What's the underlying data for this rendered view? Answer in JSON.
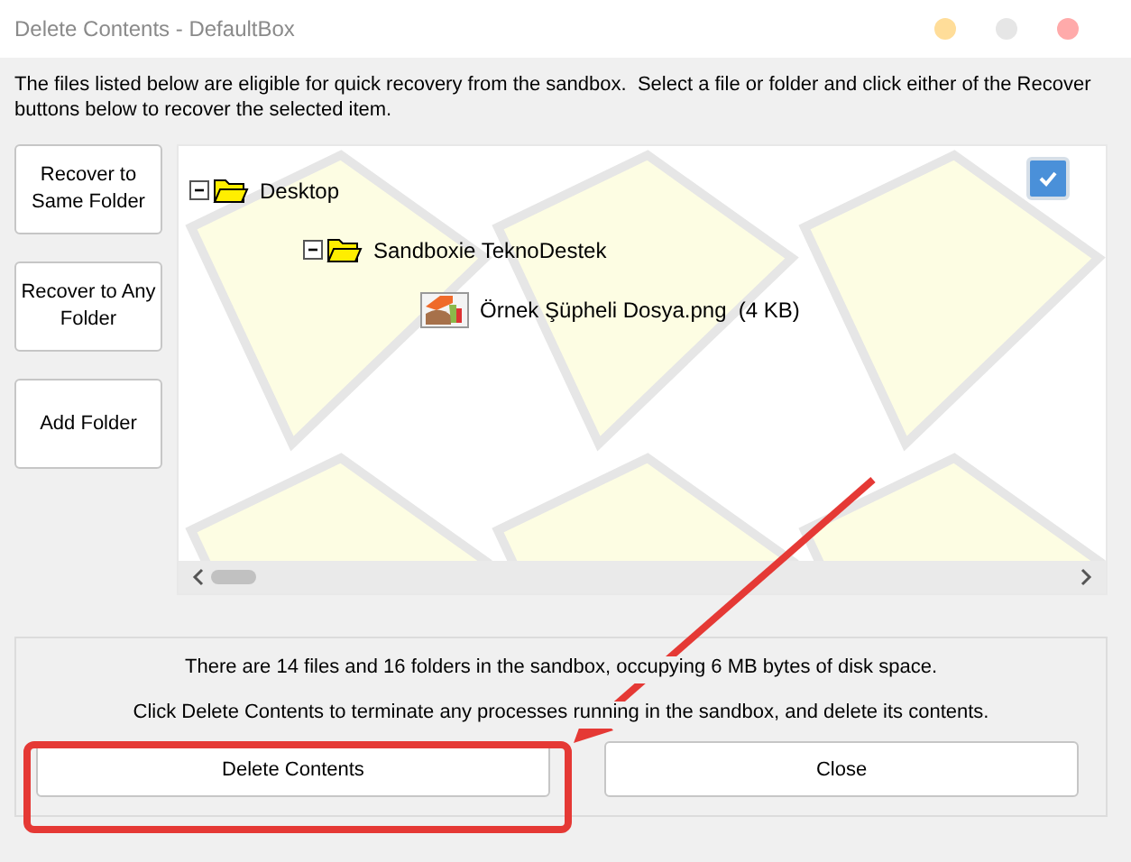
{
  "window": {
    "title": "Delete Contents - DefaultBox"
  },
  "description": "The files listed below are eligible for quick recovery from the sandbox.  Select a file or folder and click either of the Recover buttons below to recover the selected item.",
  "side_buttons": [
    "Recover to Same Folder",
    "Recover to Any Folder",
    "Add Folder"
  ],
  "tree": [
    {
      "kind": "folder",
      "label": "Desktop",
      "expanded": true,
      "children": [
        {
          "kind": "folder",
          "label": "Sandboxie TeknoDestek",
          "expanded": true,
          "children": [
            {
              "kind": "file",
              "label": "Örnek Şüpheli Dosya.png  (4 KB)"
            }
          ]
        }
      ]
    }
  ],
  "select_all": {
    "checked": true
  },
  "summary": [
    "There are 14 files and 16 folders in the sandbox, occupying 6 MB bytes of disk space.",
    "Click Delete Contents to terminate any processes running in the sandbox, and delete its contents."
  ],
  "buttons": [
    "Delete Contents",
    "Close"
  ]
}
